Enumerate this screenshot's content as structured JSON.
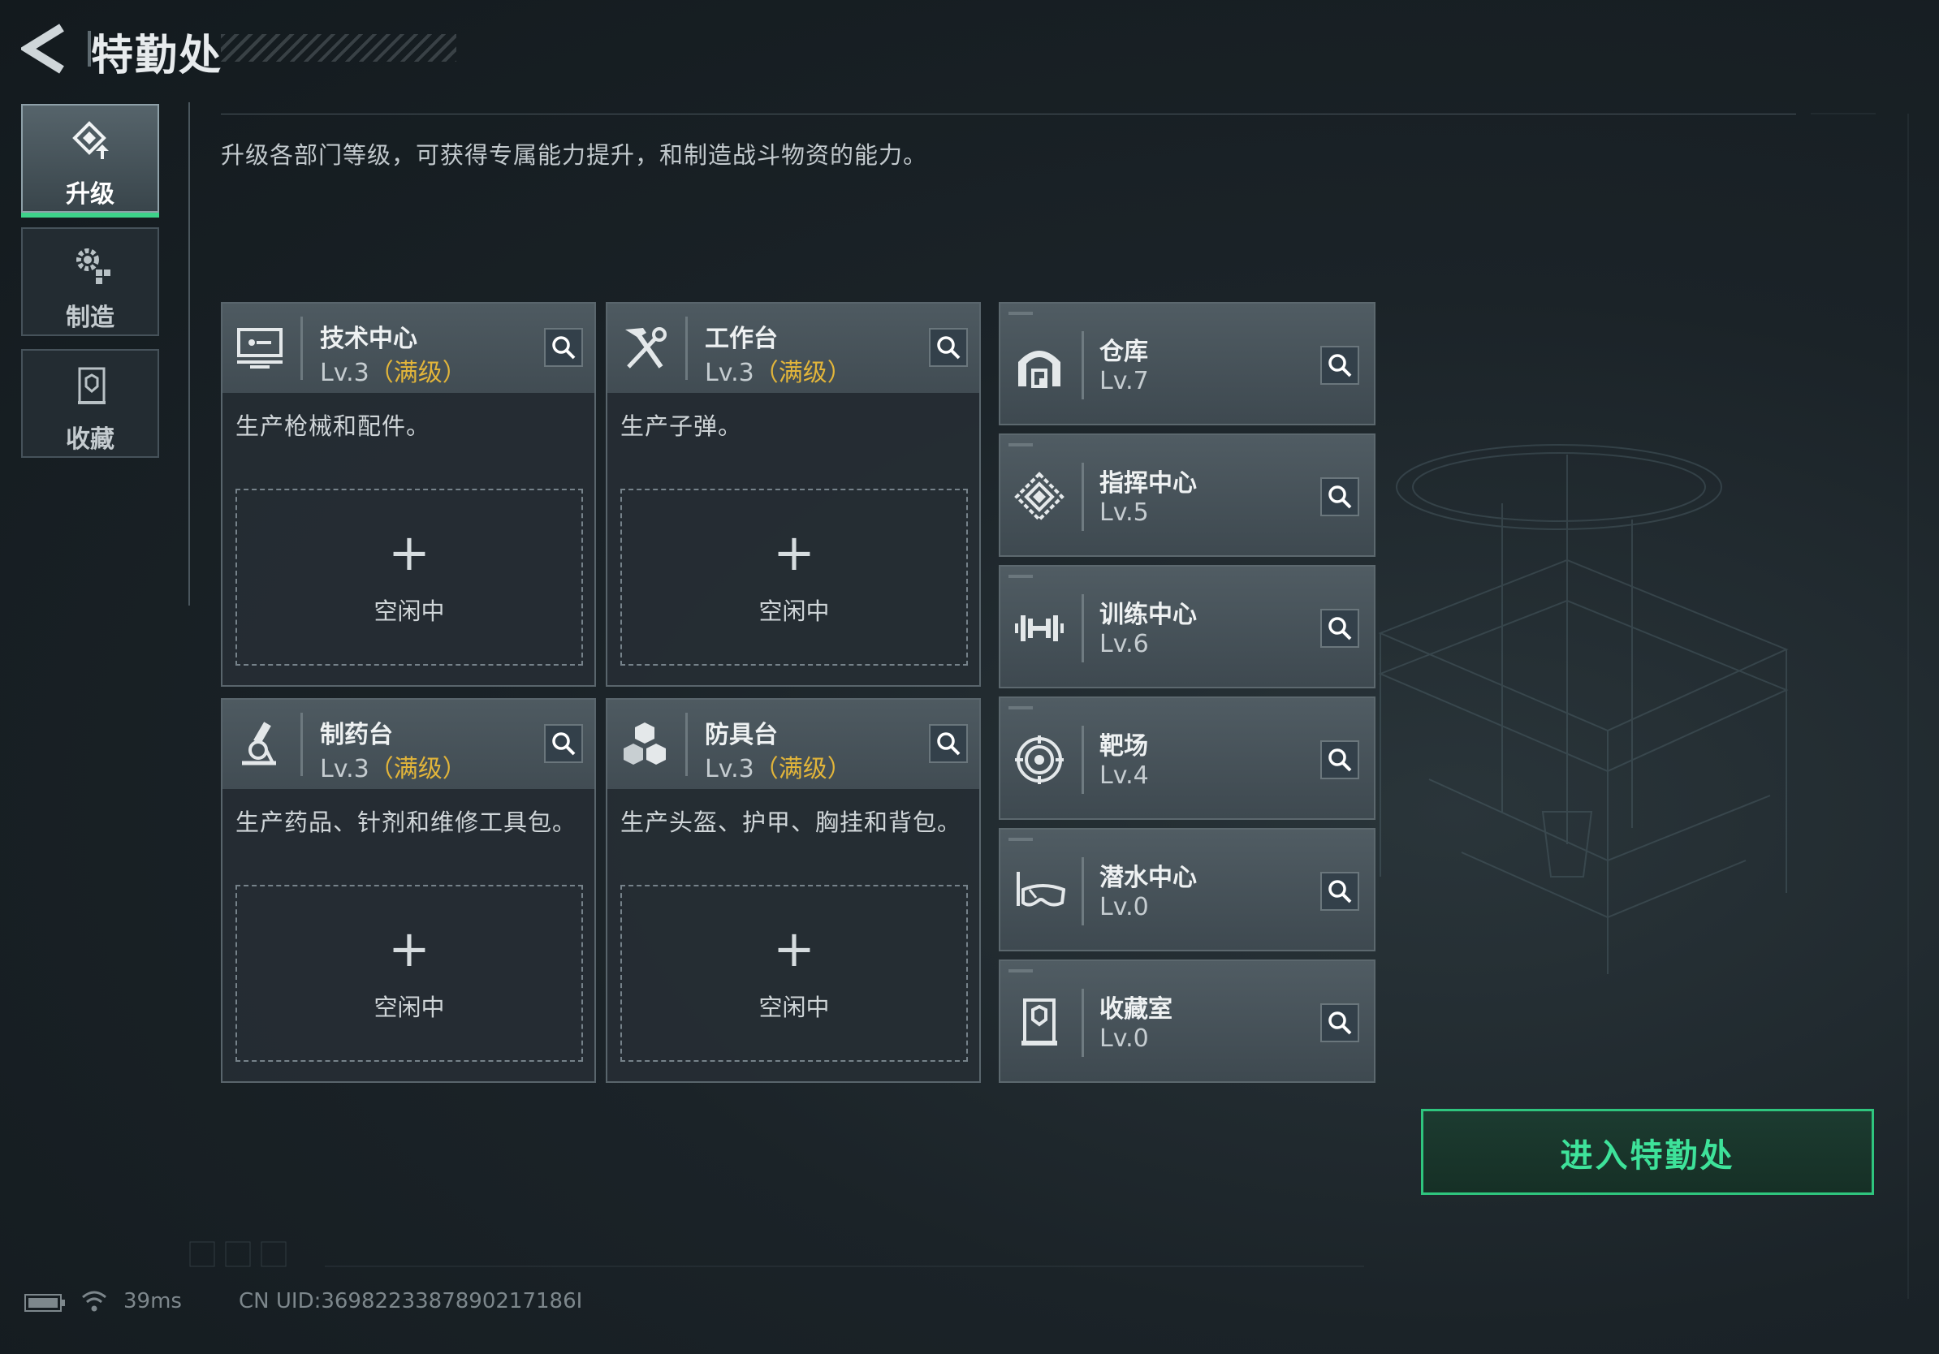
{
  "header": {
    "title": "特勤处"
  },
  "sidebar": {
    "items": [
      {
        "label": "升级",
        "icon": "upgrade-icon",
        "active": true
      },
      {
        "label": "制造",
        "icon": "gears-icon",
        "active": false
      },
      {
        "label": "收藏",
        "icon": "collection-icon",
        "active": false
      }
    ]
  },
  "description": "升级各部门等级，可获得专属能力提升，和制造战斗物资的能力。",
  "stations": [
    {
      "name": "技术中心",
      "level": "Lv.3",
      "max_tag": "（满级）",
      "desc": "生产枪械和配件。",
      "icon": "monitor-icon",
      "slot_label": "空闲中"
    },
    {
      "name": "工作台",
      "level": "Lv.3",
      "max_tag": "（满级）",
      "desc": "生产子弹。",
      "icon": "tools-icon",
      "slot_label": "空闲中"
    },
    {
      "name": "制药台",
      "level": "Lv.3",
      "max_tag": "（满级）",
      "desc": "生产药品、针剂和维修工具包。",
      "icon": "microscope-icon",
      "slot_label": "空闲中"
    },
    {
      "name": "防具台",
      "level": "Lv.3",
      "max_tag": "（满级）",
      "desc": "生产头盔、护甲、胸挂和背包。",
      "icon": "boxes-icon",
      "slot_label": "空闲中"
    }
  ],
  "facilities": [
    {
      "name": "仓库",
      "level": "Lv.7",
      "icon": "warehouse-icon"
    },
    {
      "name": "指挥中心",
      "level": "Lv.5",
      "icon": "command-icon"
    },
    {
      "name": "训练中心",
      "level": "Lv.6",
      "icon": "dumbbell-icon"
    },
    {
      "name": "靶场",
      "level": "Lv.4",
      "icon": "target-icon"
    },
    {
      "name": "潜水中心",
      "level": "Lv.0",
      "icon": "diving-mask-icon"
    },
    {
      "name": "收藏室",
      "level": "Lv.0",
      "icon": "vault-icon"
    }
  ],
  "enter_button": "进入特勤处",
  "status": {
    "ping": "39ms",
    "uid": "CN UID:3698223387890217186I"
  },
  "colors": {
    "accent_green": "#3ee29a",
    "max_level_gold": "#e2b53a"
  }
}
